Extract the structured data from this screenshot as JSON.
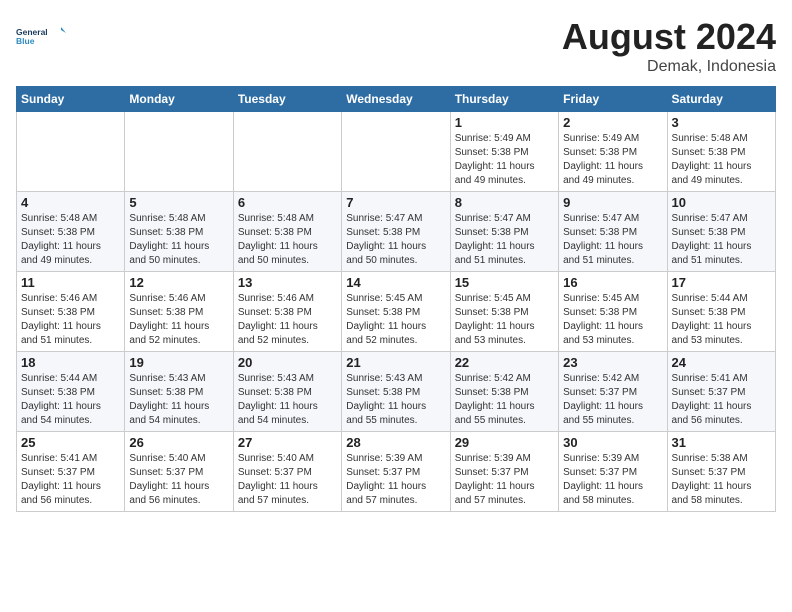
{
  "header": {
    "logo_line1": "General",
    "logo_line2": "Blue",
    "month": "August 2024",
    "location": "Demak, Indonesia"
  },
  "days_of_week": [
    "Sunday",
    "Monday",
    "Tuesday",
    "Wednesday",
    "Thursday",
    "Friday",
    "Saturday"
  ],
  "weeks": [
    [
      {
        "day": "",
        "info": ""
      },
      {
        "day": "",
        "info": ""
      },
      {
        "day": "",
        "info": ""
      },
      {
        "day": "",
        "info": ""
      },
      {
        "day": "1",
        "info": "Sunrise: 5:49 AM\nSunset: 5:38 PM\nDaylight: 11 hours\nand 49 minutes."
      },
      {
        "day": "2",
        "info": "Sunrise: 5:49 AM\nSunset: 5:38 PM\nDaylight: 11 hours\nand 49 minutes."
      },
      {
        "day": "3",
        "info": "Sunrise: 5:48 AM\nSunset: 5:38 PM\nDaylight: 11 hours\nand 49 minutes."
      }
    ],
    [
      {
        "day": "4",
        "info": "Sunrise: 5:48 AM\nSunset: 5:38 PM\nDaylight: 11 hours\nand 49 minutes."
      },
      {
        "day": "5",
        "info": "Sunrise: 5:48 AM\nSunset: 5:38 PM\nDaylight: 11 hours\nand 50 minutes."
      },
      {
        "day": "6",
        "info": "Sunrise: 5:48 AM\nSunset: 5:38 PM\nDaylight: 11 hours\nand 50 minutes."
      },
      {
        "day": "7",
        "info": "Sunrise: 5:47 AM\nSunset: 5:38 PM\nDaylight: 11 hours\nand 50 minutes."
      },
      {
        "day": "8",
        "info": "Sunrise: 5:47 AM\nSunset: 5:38 PM\nDaylight: 11 hours\nand 51 minutes."
      },
      {
        "day": "9",
        "info": "Sunrise: 5:47 AM\nSunset: 5:38 PM\nDaylight: 11 hours\nand 51 minutes."
      },
      {
        "day": "10",
        "info": "Sunrise: 5:47 AM\nSunset: 5:38 PM\nDaylight: 11 hours\nand 51 minutes."
      }
    ],
    [
      {
        "day": "11",
        "info": "Sunrise: 5:46 AM\nSunset: 5:38 PM\nDaylight: 11 hours\nand 51 minutes."
      },
      {
        "day": "12",
        "info": "Sunrise: 5:46 AM\nSunset: 5:38 PM\nDaylight: 11 hours\nand 52 minutes."
      },
      {
        "day": "13",
        "info": "Sunrise: 5:46 AM\nSunset: 5:38 PM\nDaylight: 11 hours\nand 52 minutes."
      },
      {
        "day": "14",
        "info": "Sunrise: 5:45 AM\nSunset: 5:38 PM\nDaylight: 11 hours\nand 52 minutes."
      },
      {
        "day": "15",
        "info": "Sunrise: 5:45 AM\nSunset: 5:38 PM\nDaylight: 11 hours\nand 53 minutes."
      },
      {
        "day": "16",
        "info": "Sunrise: 5:45 AM\nSunset: 5:38 PM\nDaylight: 11 hours\nand 53 minutes."
      },
      {
        "day": "17",
        "info": "Sunrise: 5:44 AM\nSunset: 5:38 PM\nDaylight: 11 hours\nand 53 minutes."
      }
    ],
    [
      {
        "day": "18",
        "info": "Sunrise: 5:44 AM\nSunset: 5:38 PM\nDaylight: 11 hours\nand 54 minutes."
      },
      {
        "day": "19",
        "info": "Sunrise: 5:43 AM\nSunset: 5:38 PM\nDaylight: 11 hours\nand 54 minutes."
      },
      {
        "day": "20",
        "info": "Sunrise: 5:43 AM\nSunset: 5:38 PM\nDaylight: 11 hours\nand 54 minutes."
      },
      {
        "day": "21",
        "info": "Sunrise: 5:43 AM\nSunset: 5:38 PM\nDaylight: 11 hours\nand 55 minutes."
      },
      {
        "day": "22",
        "info": "Sunrise: 5:42 AM\nSunset: 5:38 PM\nDaylight: 11 hours\nand 55 minutes."
      },
      {
        "day": "23",
        "info": "Sunrise: 5:42 AM\nSunset: 5:37 PM\nDaylight: 11 hours\nand 55 minutes."
      },
      {
        "day": "24",
        "info": "Sunrise: 5:41 AM\nSunset: 5:37 PM\nDaylight: 11 hours\nand 56 minutes."
      }
    ],
    [
      {
        "day": "25",
        "info": "Sunrise: 5:41 AM\nSunset: 5:37 PM\nDaylight: 11 hours\nand 56 minutes."
      },
      {
        "day": "26",
        "info": "Sunrise: 5:40 AM\nSunset: 5:37 PM\nDaylight: 11 hours\nand 56 minutes."
      },
      {
        "day": "27",
        "info": "Sunrise: 5:40 AM\nSunset: 5:37 PM\nDaylight: 11 hours\nand 57 minutes."
      },
      {
        "day": "28",
        "info": "Sunrise: 5:39 AM\nSunset: 5:37 PM\nDaylight: 11 hours\nand 57 minutes."
      },
      {
        "day": "29",
        "info": "Sunrise: 5:39 AM\nSunset: 5:37 PM\nDaylight: 11 hours\nand 57 minutes."
      },
      {
        "day": "30",
        "info": "Sunrise: 5:39 AM\nSunset: 5:37 PM\nDaylight: 11 hours\nand 58 minutes."
      },
      {
        "day": "31",
        "info": "Sunrise: 5:38 AM\nSunset: 5:37 PM\nDaylight: 11 hours\nand 58 minutes."
      }
    ]
  ]
}
